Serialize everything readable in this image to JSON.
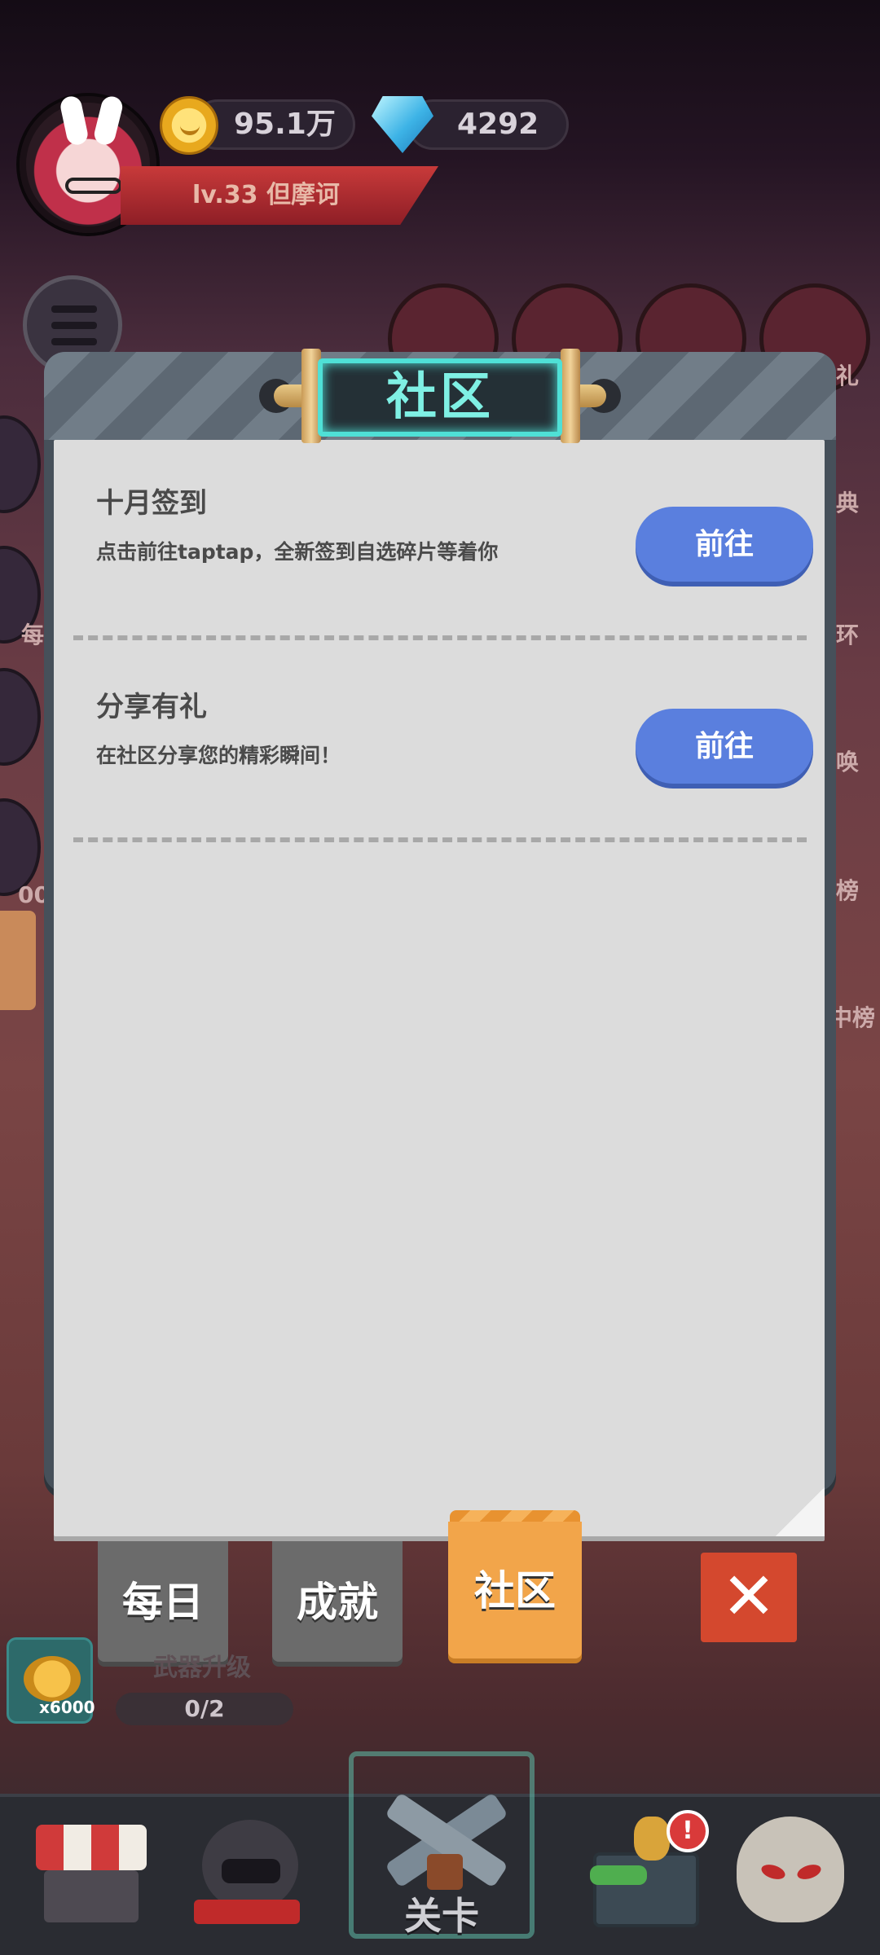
{
  "hud": {
    "coins": "95.1万",
    "gems": "4292",
    "level_name": "lv.33  但摩诃"
  },
  "side": {
    "left_labels": [
      "每",
      "00"
    ],
    "right_labels": [
      "礼",
      "典",
      "环",
      "唤",
      "榜",
      "中榜"
    ]
  },
  "modal": {
    "title": "社区",
    "tasks": [
      {
        "title": "十月签到",
        "desc": "点击前往taptap，全新签到自选碎片等着你",
        "button": "前往"
      },
      {
        "title": "分享有礼",
        "desc": "在社区分享您的精彩瞬间！",
        "button": "前往"
      }
    ],
    "tabs": [
      {
        "label": "每日",
        "active": false
      },
      {
        "label": "成就",
        "active": false
      },
      {
        "label": "社区",
        "active": true
      }
    ],
    "close_icon": "close-x"
  },
  "below": {
    "reward_count": "x6000",
    "weapon_upgrade": "武器升级",
    "progress": "0/2",
    "progress_value": 0
  },
  "nav": {
    "level_label": "关卡",
    "notification_badge": "!",
    "items": [
      "shop-icon",
      "knight-icon",
      "level-icon",
      "chest-icon",
      "skull-icon"
    ]
  },
  "colors": {
    "accent_button": "#5a7fde",
    "active_tab": "#f2a54a",
    "title_glow": "#4fe0d6",
    "close_button": "#d4482e"
  }
}
